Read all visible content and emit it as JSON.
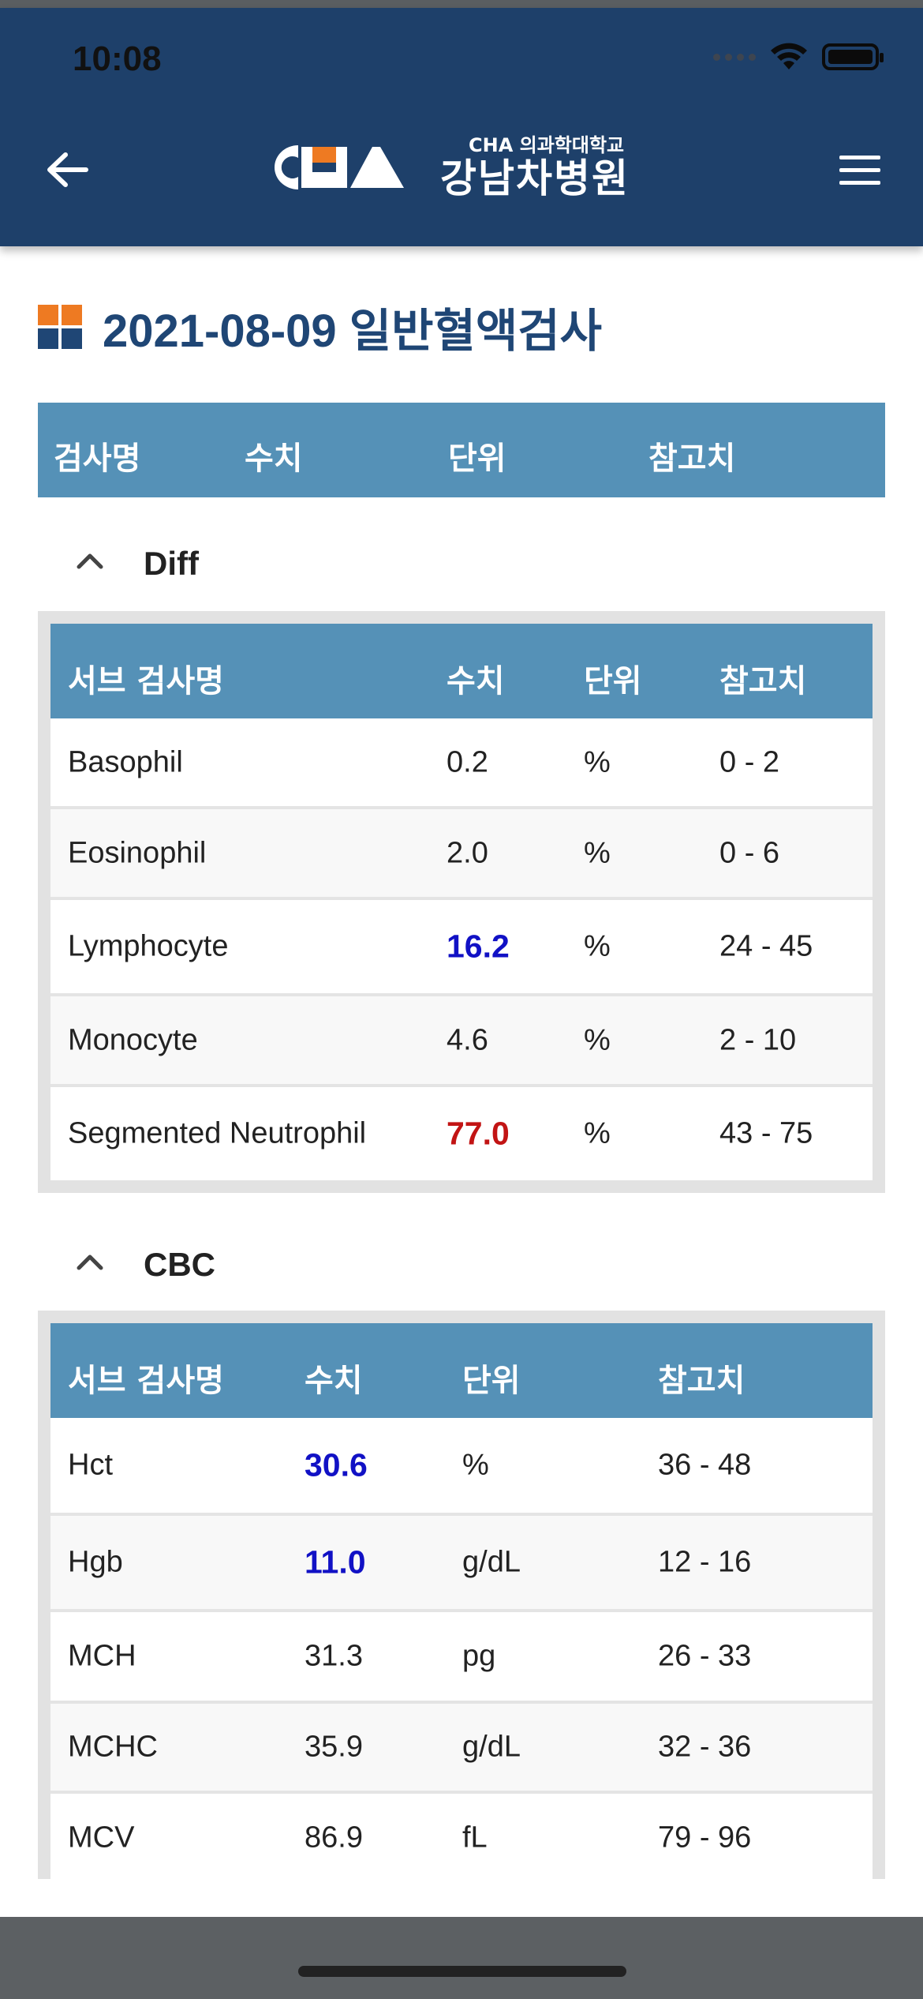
{
  "status_bar": {
    "time": "10:08"
  },
  "header": {
    "logo_sub": "CHA 의과학대학교",
    "logo_main": "강남차병원",
    "brand_color": "#1e406a"
  },
  "page": {
    "title": "2021-08-09 일반혈액검사"
  },
  "main_table": {
    "headers": [
      "검사명",
      "수치",
      "단위",
      "참고치"
    ]
  },
  "sections": [
    {
      "name": "Diff",
      "headers": [
        "서브 검사명",
        "수치",
        "단위",
        "참고치"
      ],
      "rows": [
        {
          "name": "Basophil",
          "value": "0.2",
          "unit": "%",
          "ref": "0 - 2",
          "flag": "normal"
        },
        {
          "name": "Eosinophil",
          "value": "2.0",
          "unit": "%",
          "ref": "0 - 6",
          "flag": "normal"
        },
        {
          "name": "Lymphocyte",
          "value": "16.2",
          "unit": "%",
          "ref": "24 - 45",
          "flag": "low"
        },
        {
          "name": "Monocyte",
          "value": "4.6",
          "unit": "%",
          "ref": "2 - 10",
          "flag": "normal"
        },
        {
          "name": "Segmented Neutrophil",
          "value": "77.0",
          "unit": "%",
          "ref": "43 - 75",
          "flag": "high"
        }
      ]
    },
    {
      "name": "CBC",
      "headers": [
        "서브 검사명",
        "수치",
        "단위",
        "참고치"
      ],
      "rows": [
        {
          "name": "Hct",
          "value": "30.6",
          "unit": "%",
          "ref": "36 - 48",
          "flag": "low"
        },
        {
          "name": "Hgb",
          "value": "11.0",
          "unit": "g/dL",
          "ref": "12 - 16",
          "flag": "low"
        },
        {
          "name": "MCH",
          "value": "31.3",
          "unit": "pg",
          "ref": "26 - 33",
          "flag": "normal"
        },
        {
          "name": "MCHC",
          "value": "35.9",
          "unit": "g/dL",
          "ref": "32 - 36",
          "flag": "normal"
        },
        {
          "name": "MCV",
          "value": "86.9",
          "unit": "fL",
          "ref": "79 - 96",
          "flag": "normal"
        }
      ]
    }
  ],
  "colors": {
    "table_header": "#5591b7",
    "low_value": "#1111c5",
    "high_value": "#c21414",
    "title_icon_orange": "#ee7a22",
    "title_icon_navy": "#1f4675"
  },
  "icons": {
    "back": "arrow-left-icon",
    "menu": "hamburger-menu-icon",
    "collapse": "chevron-up-icon"
  }
}
